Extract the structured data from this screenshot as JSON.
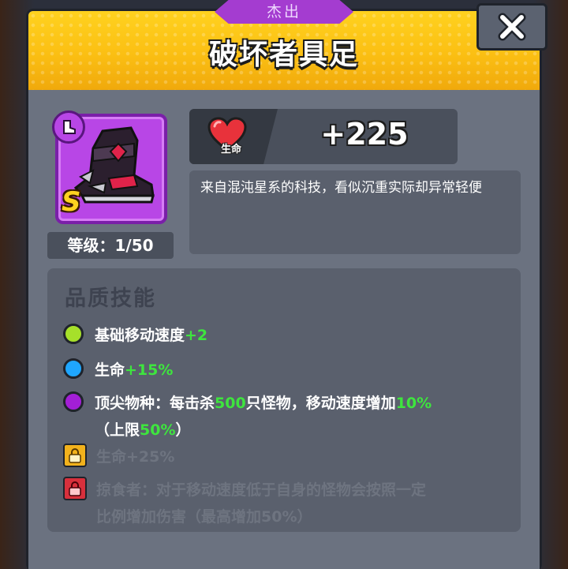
{
  "window": {
    "rarity": "杰出",
    "title": "破坏者具足"
  },
  "close": {
    "icon": "close-icon"
  },
  "item": {
    "type_icon": "boot-icon",
    "grade": "S",
    "level_text": "等级：1/50",
    "frame_color": "#b846e6"
  },
  "stat": {
    "icon": "heart-icon",
    "label": "生命",
    "value": "+225"
  },
  "description": "来自混沌星系的科技，看似沉重实际却异常轻便",
  "skills": {
    "title": "品质技能",
    "items": [
      {
        "dot_color": "#a6e02a",
        "parts": [
          "基础移动速度",
          "+2"
        ]
      },
      {
        "dot_color": "#1fa6ff",
        "parts": [
          "生命",
          "+15%"
        ]
      },
      {
        "dot_color": "#a31fd6",
        "parts": [
          "顶尖物种：每击杀",
          "500",
          "只怪物，移动速度增加",
          "10%"
        ],
        "line2": [
          "（上限",
          "50%",
          "）"
        ]
      },
      {
        "lock_color": "#f2b21c",
        "locked": true,
        "text": "生命+25%"
      },
      {
        "lock_color": "#d8303c",
        "locked": true,
        "text": "掠食者：对于移动速度低于自身的怪物会按照一定",
        "line2": "比例增加伤害（最高增加50%）"
      }
    ]
  }
}
